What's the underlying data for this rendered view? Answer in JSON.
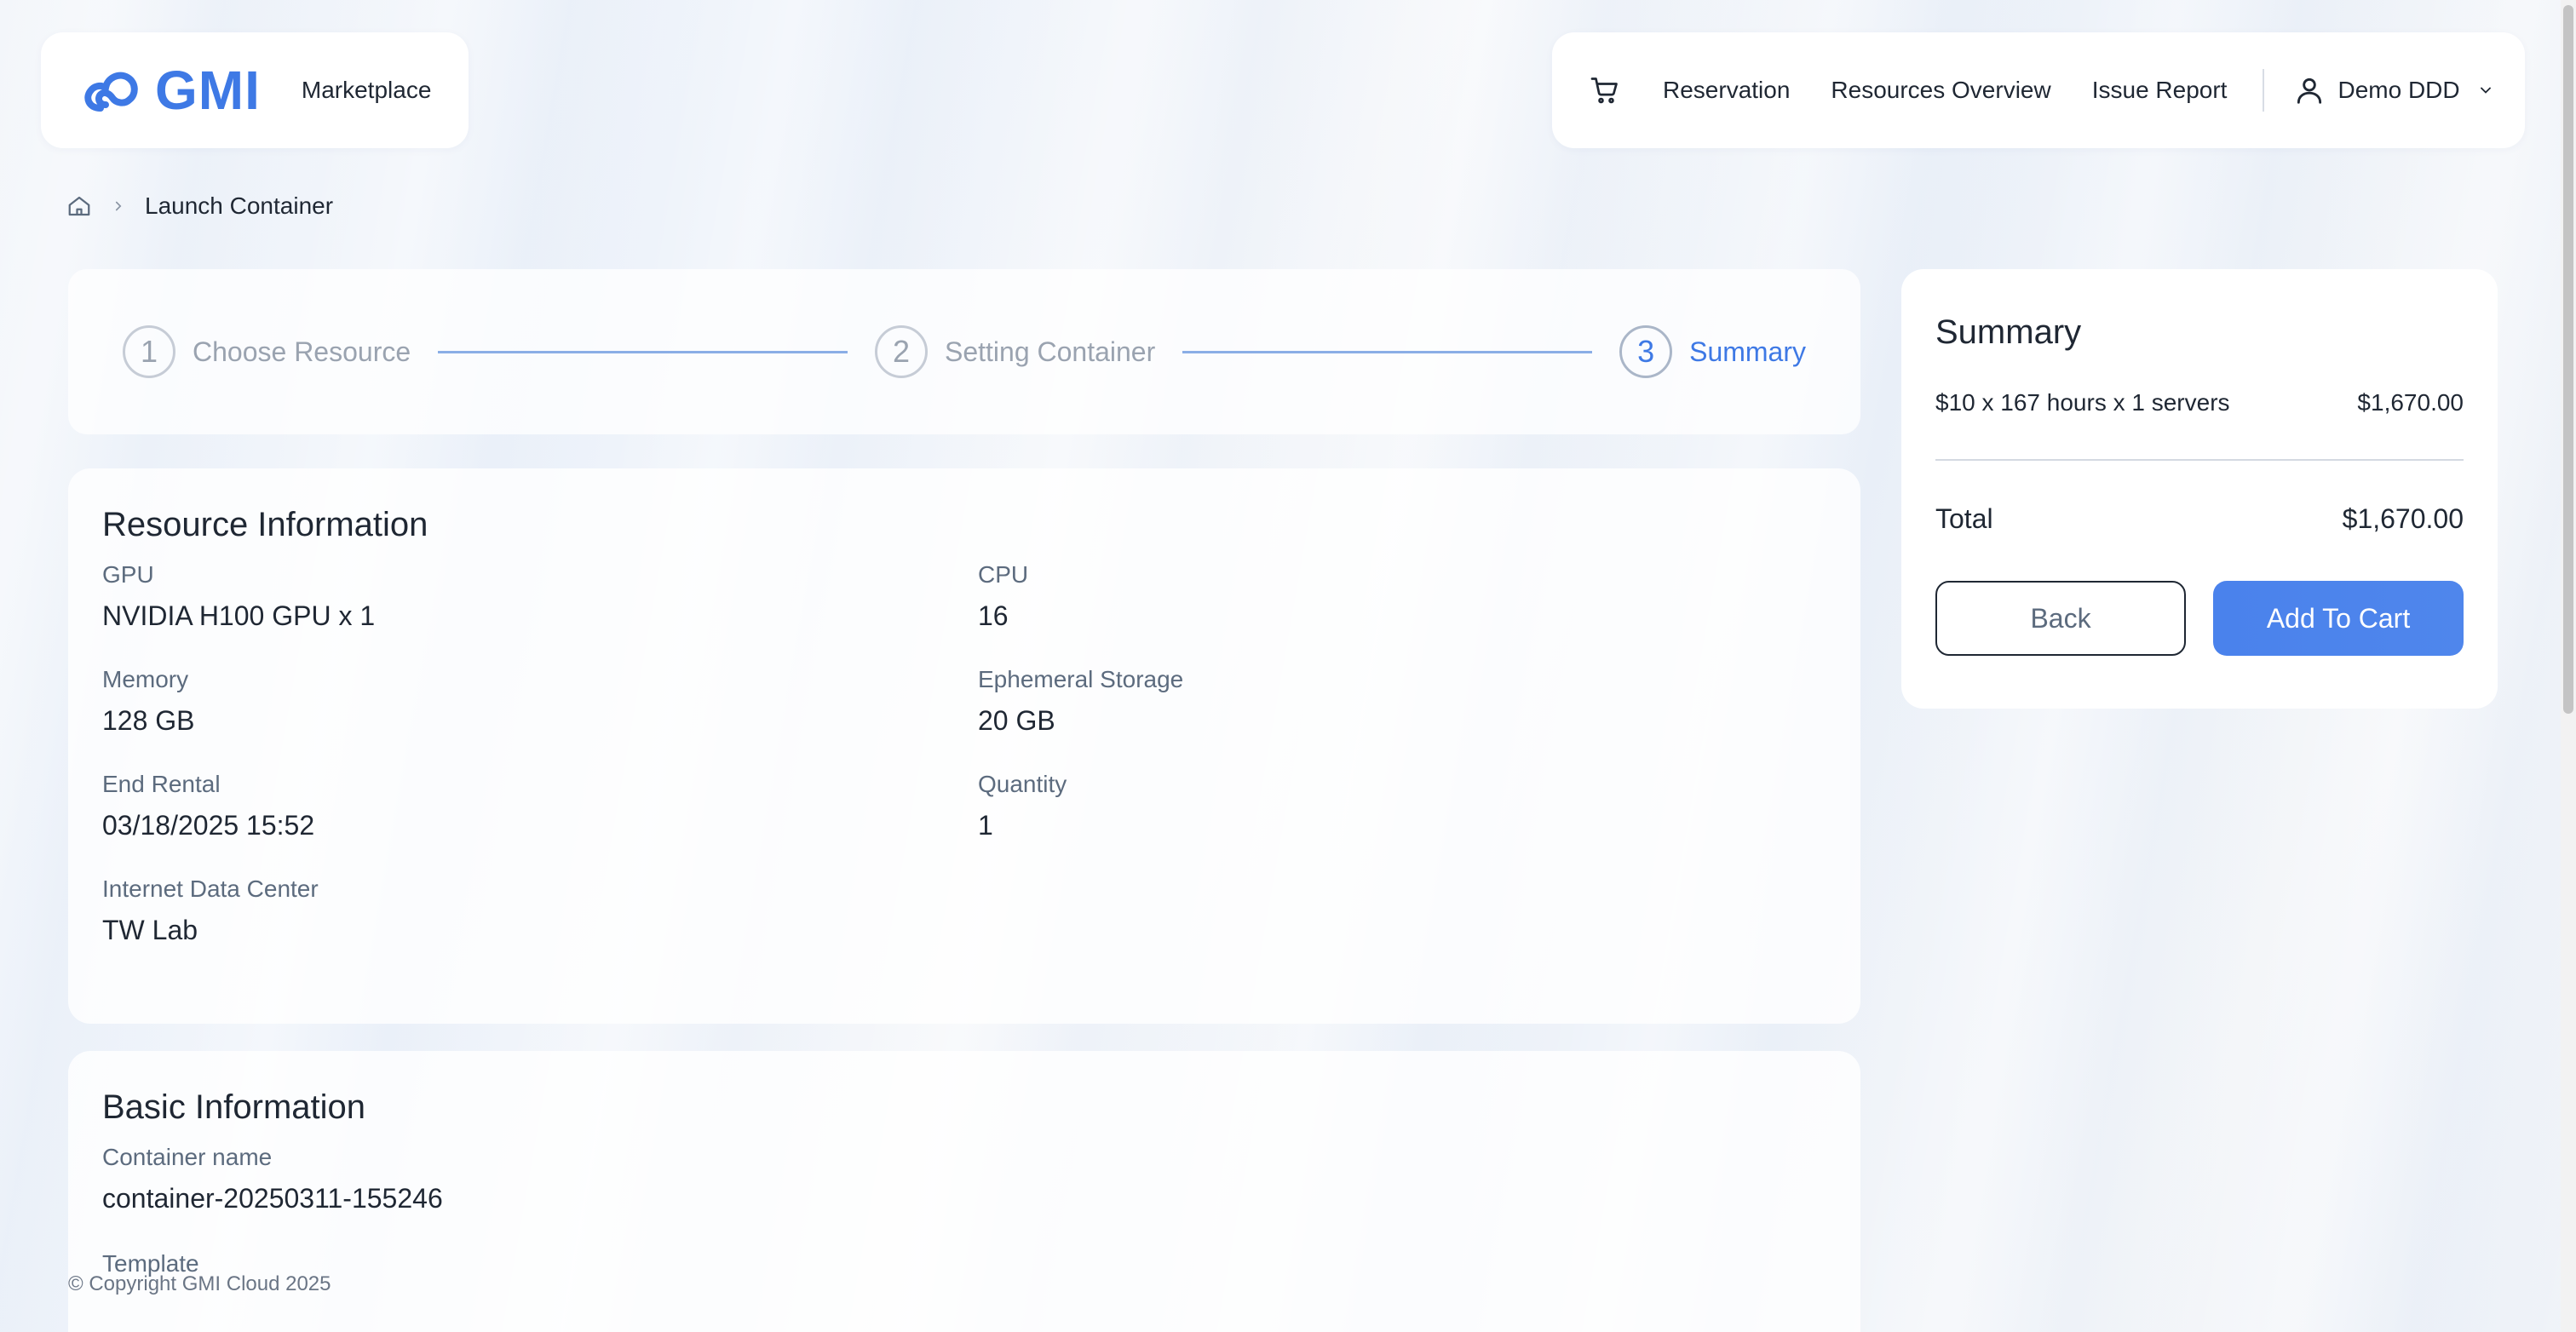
{
  "header": {
    "logo_text": "GMI",
    "marketplace": "Marketplace",
    "nav": [
      "Reservation",
      "Resources Overview",
      "Issue Report"
    ],
    "user_name": "Demo DDD"
  },
  "breadcrumb": {
    "current": "Launch Container"
  },
  "steps": [
    {
      "num": "1",
      "label": "Choose Resource"
    },
    {
      "num": "2",
      "label": "Setting Container"
    },
    {
      "num": "3",
      "label": "Summary"
    }
  ],
  "resource": {
    "title": "Resource Information",
    "gpu_label": "GPU",
    "gpu_value": "NVIDIA H100 GPU x 1",
    "cpu_label": "CPU",
    "cpu_value": "16",
    "memory_label": "Memory",
    "memory_value": "128 GB",
    "storage_label": "Ephemeral Storage",
    "storage_value": "20 GB",
    "end_label": "End Rental",
    "end_value": "03/18/2025 15:52",
    "qty_label": "Quantity",
    "qty_value": "1",
    "idc_label": "Internet Data Center",
    "idc_value": "TW Lab"
  },
  "basic": {
    "title": "Basic Information",
    "name_label": "Container name",
    "name_value": "container-20250311-155246",
    "template_label": "Template"
  },
  "summary": {
    "title": "Summary",
    "line_desc": "$10 x 167 hours x 1 servers",
    "line_amount": "$1,670.00",
    "total_label": "Total",
    "total_amount": "$1,670.00",
    "back_label": "Back",
    "add_label": "Add To Cart"
  },
  "footer": "© Copyright GMI Cloud 2025"
}
